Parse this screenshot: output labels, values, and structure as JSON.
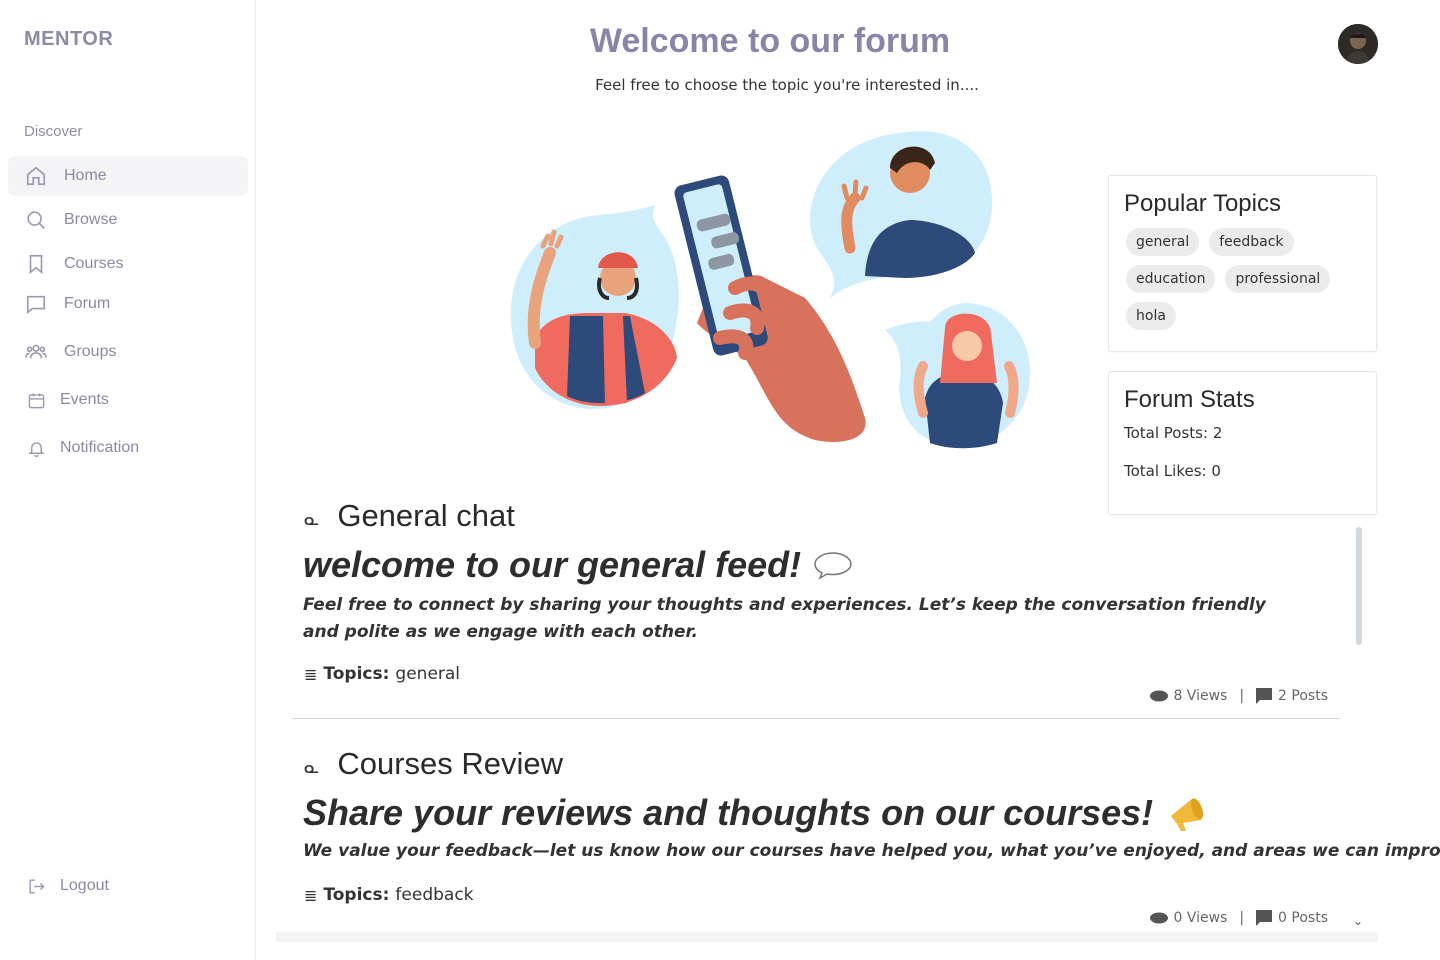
{
  "brand": "MENTOR",
  "sidebar": {
    "section_label": "Discover",
    "items": [
      {
        "label": "Home",
        "icon": "home-icon"
      },
      {
        "label": "Browse",
        "icon": "search-icon"
      },
      {
        "label": "Courses",
        "icon": "bookmark-icon"
      },
      {
        "label": "Forum",
        "icon": "chat-icon"
      },
      {
        "label": "Groups",
        "icon": "users-icon"
      },
      {
        "label": "Events",
        "icon": "calendar-icon"
      },
      {
        "label": "Notification",
        "icon": "bell-icon"
      }
    ],
    "logout_label": "Logout"
  },
  "header": {
    "title": "Welcome to our forum",
    "subtitle": "Feel free to choose the topic you're interested in...."
  },
  "popular_topics": {
    "title": "Popular Topics",
    "tags": [
      "general",
      "feedback",
      "education",
      "professional",
      "hola"
    ]
  },
  "forum_stats": {
    "title": "Forum Stats",
    "total_posts": "Total Posts: 2",
    "total_likes": "Total Likes: 0"
  },
  "feed": [
    {
      "title": "General chat",
      "heading": "welcome to our general feed!",
      "description": "Feel free to connect by sharing your thoughts and experiences. Let’s keep the conversation friendly and polite as we engage with each other.",
      "topics_label": "Topics:",
      "topics_value": "general",
      "views": "8 Views",
      "posts": "2 Posts"
    },
    {
      "title": "Courses Review",
      "heading": "Share your reviews and thoughts on our courses!",
      "description": "We value your feedback—let us know how our courses have helped you, what you’ve enjoyed, and areas we can improve",
      "topics_label": "Topics:",
      "topics_value": "feedback",
      "views": "0 Views",
      "posts": "0 Posts"
    }
  ],
  "colors": {
    "accent": "#8b84a8",
    "sidebar_text": "#8a8aa0",
    "bubble": "#cdeefa",
    "megaphone": "#f2b83a"
  }
}
